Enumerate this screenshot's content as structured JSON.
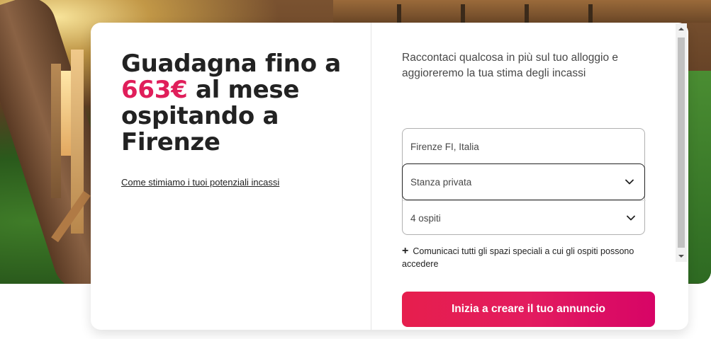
{
  "headline": {
    "line1": "Guadagna fino a",
    "amount": "663€",
    "line2_rest": " al mese",
    "line3": "ospitando a",
    "line4": "Firenze"
  },
  "estimate_link": "Come stimiamo i tuoi potenziali incassi",
  "intro_text": "Raccontaci qualcosa in più sul tuo alloggio e aggioreremo la tua stima degli incassi",
  "form": {
    "location_value": "Firenze FI, Italia",
    "room_type_value": "Stanza privata",
    "guests_value": "4 ospiti"
  },
  "add_spaces_label": "Comunicaci tutti gli spazi speciali a cui gli ospiti possono accedere",
  "cta_label": "Inizia a creare il tuo annuncio",
  "colors": {
    "accent": "#e01e5a",
    "cta_start": "#e61e4d",
    "cta_end": "#d70466"
  },
  "icons": {
    "dropdown": "chevron-down-icon",
    "add": "plus-icon",
    "scroll_up": "scroll-up-arrow-icon",
    "scroll_down": "scroll-down-arrow-icon"
  }
}
